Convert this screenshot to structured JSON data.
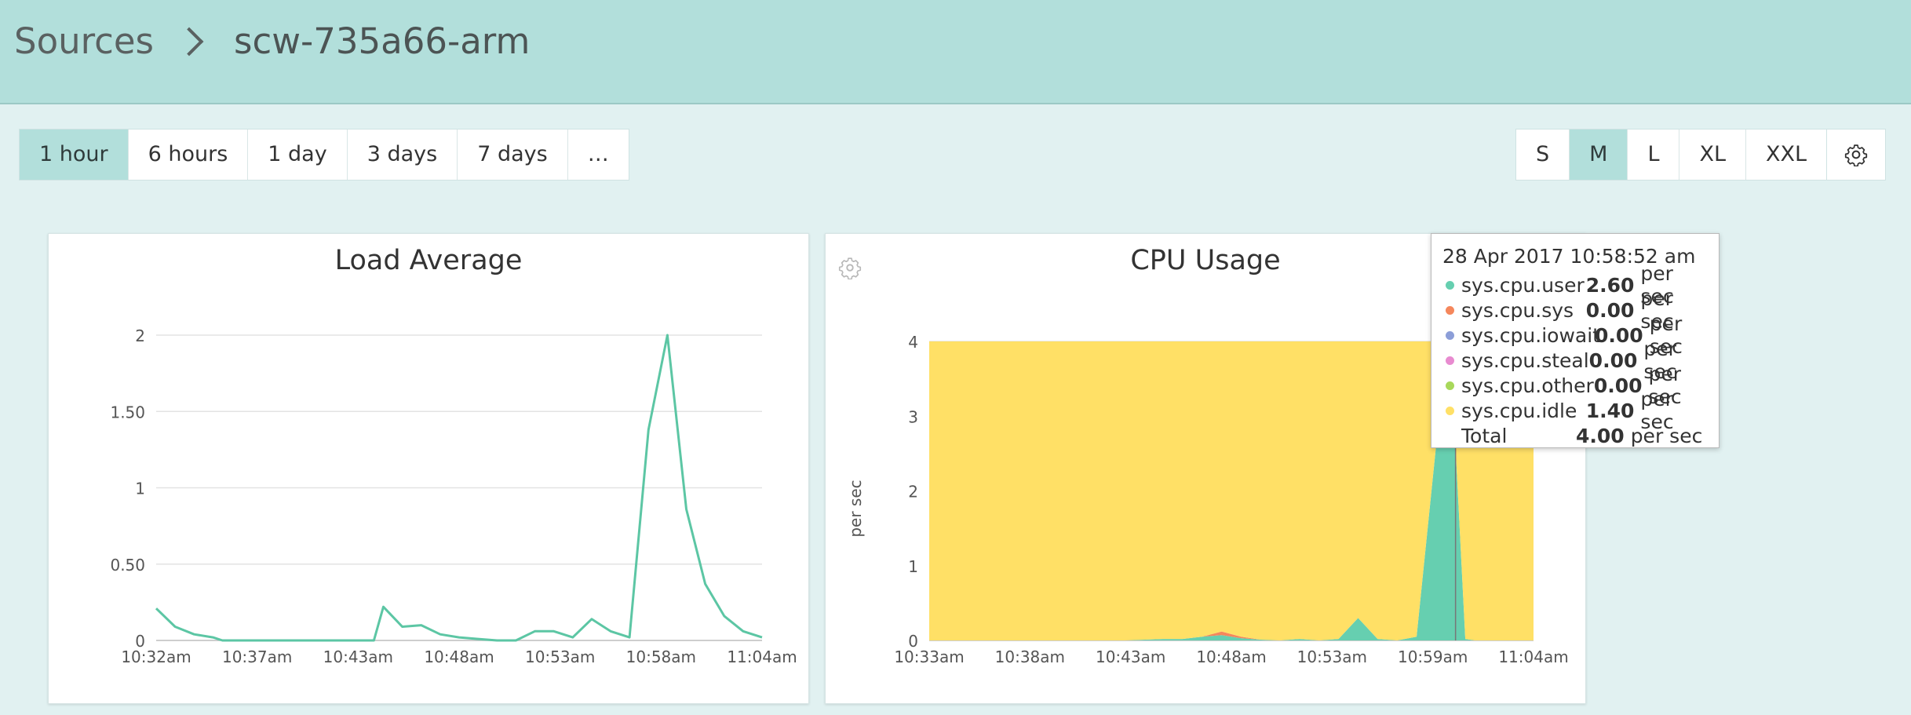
{
  "breadcrumb": {
    "root": "Sources",
    "current": "scw-735a66-arm"
  },
  "time_ranges": {
    "items": [
      "1 hour",
      "6 hours",
      "1 day",
      "3 days",
      "7 days",
      "…"
    ],
    "selected": "1 hour"
  },
  "sizes": {
    "items": [
      "S",
      "M",
      "L",
      "XL",
      "XXL"
    ],
    "selected": "M"
  },
  "icons": {
    "settings": "gear-icon",
    "panel_settings": "gear-icon",
    "breadcrumb_separator": "chevron-right-icon"
  },
  "colors": {
    "header_bg": "#b2dfdb",
    "page_bg": "#e1f1f1",
    "load_line": "#5cc6a4",
    "cpu_user": "#66cfb0",
    "cpu_sys": "#f5875c",
    "cpu_iowait": "#8c9ed8",
    "cpu_steal": "#e88bd0",
    "cpu_other": "#a8d85b",
    "cpu_idle": "#ffe066"
  },
  "panels": {
    "load": {
      "title": "Load Average"
    },
    "cpu": {
      "title": "CPU Usage"
    }
  },
  "tooltip": {
    "time": "28 Apr 2017 10:58:52 am",
    "rows": [
      {
        "name": "sys.cpu.user",
        "value": "2.60",
        "unit": "per sec",
        "color": "#66cfb0"
      },
      {
        "name": "sys.cpu.sys",
        "value": "0.00",
        "unit": "per sec",
        "color": "#f5875c"
      },
      {
        "name": "sys.cpu.iowait",
        "value": "0.00",
        "unit": "per sec",
        "color": "#8c9ed8"
      },
      {
        "name": "sys.cpu.steal",
        "value": "0.00",
        "unit": "per sec",
        "color": "#e88bd0"
      },
      {
        "name": "sys.cpu.other",
        "value": "0.00",
        "unit": "per sec",
        "color": "#a8d85b"
      },
      {
        "name": "sys.cpu.idle",
        "value": "1.40",
        "unit": "per sec",
        "color": "#ffe066"
      }
    ],
    "total": {
      "name": "Total",
      "value": "4.00",
      "unit": "per sec"
    }
  },
  "chart_data": [
    {
      "type": "line",
      "title": "Load Average",
      "xlabel": "",
      "ylabel": "",
      "x_ticks": [
        "10:32am",
        "10:37am",
        "10:43am",
        "10:48am",
        "10:53am",
        "10:58am",
        "11:04am"
      ],
      "xlim": [
        0,
        32
      ],
      "y_ticks": [
        "0",
        "0.50",
        "1",
        "1.50",
        "2"
      ],
      "ylim": [
        0,
        2
      ],
      "grid": true,
      "series": [
        {
          "x": [
            0,
            1,
            2,
            3,
            3.5,
            4,
            5,
            6,
            7,
            8,
            9,
            10,
            11,
            11.5,
            12,
            13,
            14,
            15,
            16,
            17,
            18,
            19,
            20,
            21,
            22,
            23,
            24,
            25,
            26,
            27,
            28,
            29,
            30,
            31,
            32
          ],
          "values": [
            0.21,
            0.09,
            0.04,
            0.02,
            0,
            0,
            0,
            0,
            0,
            0,
            0,
            0,
            0,
            0,
            0.22,
            0.09,
            0.1,
            0.04,
            0.02,
            0.01,
            0,
            0,
            0.06,
            0.06,
            0.02,
            0.14,
            0.06,
            0.02,
            1.38,
            2.0,
            0.86,
            0.37,
            0.16,
            0.06,
            0.02
          ]
        }
      ]
    },
    {
      "type": "area",
      "title": "CPU Usage",
      "xlabel": "",
      "ylabel": "per sec",
      "x_ticks": [
        "10:33am",
        "10:38am",
        "10:43am",
        "10:48am",
        "10:53am",
        "10:59am",
        "11:04am"
      ],
      "xlim": [
        0,
        31
      ],
      "y_ticks": [
        "0",
        "1",
        "2",
        "3",
        "4"
      ],
      "ylim": [
        0,
        4
      ],
      "grid": true,
      "stacked": true,
      "x": [
        0,
        2,
        4,
        6,
        8,
        10,
        12,
        13,
        14,
        15,
        16,
        17,
        18,
        19,
        20,
        21,
        22,
        23,
        24,
        25,
        26,
        26.5,
        27,
        27.5,
        28,
        29,
        30,
        31
      ],
      "series": [
        {
          "name": "sys.cpu.user",
          "values": [
            0,
            0,
            0,
            0,
            0,
            0,
            0.02,
            0.02,
            0.05,
            0.07,
            0.03,
            0.01,
            0,
            0.02,
            0,
            0.02,
            0.3,
            0.02,
            0,
            0.05,
            2.6,
            2.6,
            2.6,
            0.02,
            0,
            0,
            0,
            0
          ]
        },
        {
          "name": "sys.cpu.sys",
          "values": [
            0,
            0,
            0,
            0,
            0,
            0,
            0,
            0,
            0,
            0.05,
            0.02,
            0,
            0,
            0,
            0,
            0,
            0,
            0,
            0,
            0,
            0,
            0,
            0,
            0,
            0,
            0,
            0,
            0
          ]
        },
        {
          "name": "sys.cpu.iowait",
          "values": [
            0,
            0,
            0,
            0,
            0,
            0,
            0,
            0,
            0,
            0,
            0,
            0,
            0,
            0,
            0,
            0,
            0,
            0,
            0,
            0,
            0,
            0,
            0,
            0,
            0,
            0,
            0,
            0
          ]
        },
        {
          "name": "sys.cpu.steal",
          "values": [
            0,
            0,
            0,
            0,
            0,
            0,
            0,
            0,
            0,
            0,
            0,
            0,
            0,
            0,
            0,
            0,
            0,
            0,
            0,
            0,
            0,
            0,
            0,
            0,
            0,
            0,
            0,
            0
          ]
        },
        {
          "name": "sys.cpu.other",
          "values": [
            0,
            0,
            0,
            0,
            0,
            0,
            0,
            0,
            0,
            0,
            0,
            0,
            0,
            0,
            0,
            0,
            0,
            0,
            0,
            0,
            0,
            0,
            0,
            0,
            0,
            0,
            0,
            0
          ]
        },
        {
          "name": "sys.cpu.idle",
          "values": [
            4,
            4,
            4,
            4,
            4,
            4,
            3.98,
            3.98,
            3.95,
            3.88,
            3.95,
            3.99,
            4,
            3.98,
            4,
            3.98,
            3.7,
            3.98,
            4,
            3.95,
            1.4,
            1.4,
            1.4,
            3.98,
            4,
            4,
            4,
            4
          ]
        }
      ],
      "hover_x": 27
    }
  ]
}
